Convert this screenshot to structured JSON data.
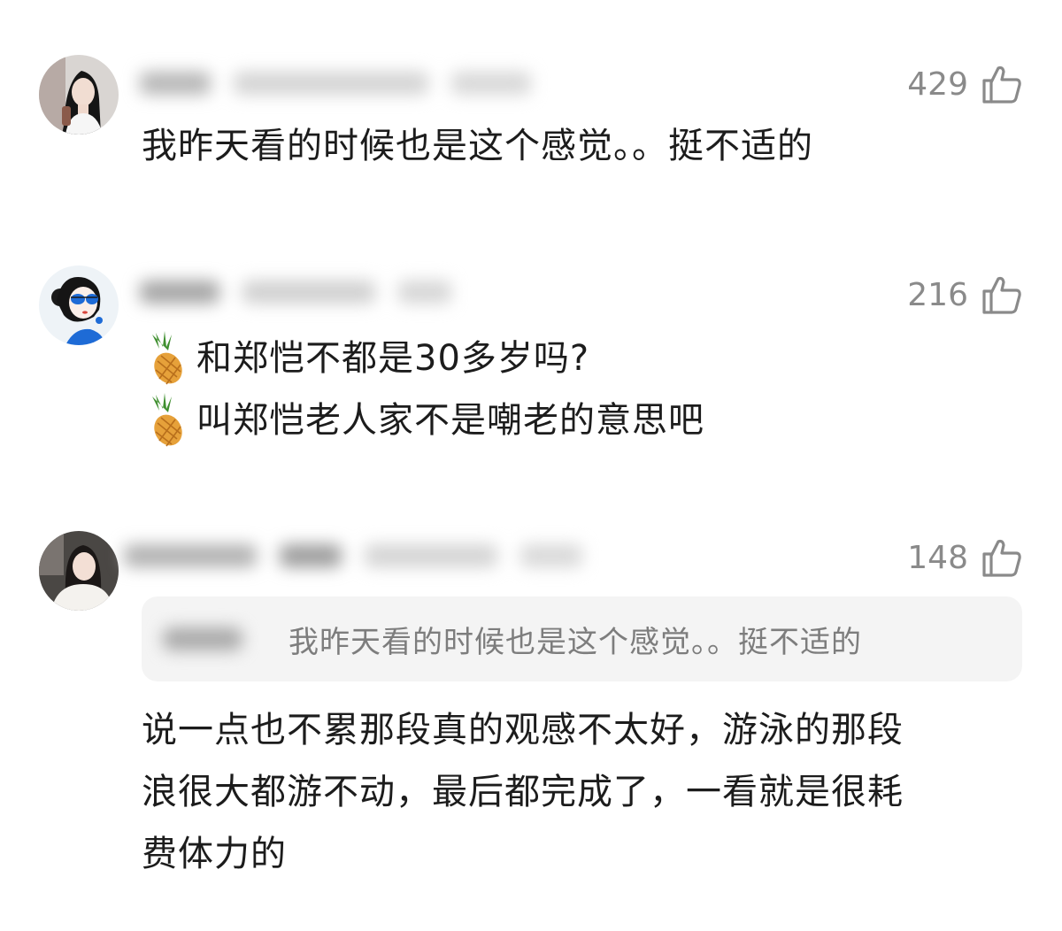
{
  "comments": [
    {
      "likes": "429",
      "lines": [
        "我昨天看的时候也是这个感觉。。挺不适的"
      ],
      "avatar_icon": "avatar-woman-dark-hair"
    },
    {
      "likes": "216",
      "lines": [
        "和郑恺不都是30多岁吗?",
        "叫郑恺老人家不是嘲老的意思吧"
      ],
      "line_emoji": "pineapple-icon",
      "avatar_icon": "avatar-illustrated-woman-blue-glasses"
    },
    {
      "likes": "148",
      "quote": "我昨天看的时候也是这个感觉。。挺不适的",
      "lines": [
        "说一点也不累那段真的观感不太好，游泳的那段",
        "浪很大都游不动，最后都完成了，一看就是很耗",
        "费体力的"
      ],
      "avatar_icon": "avatar-woman-white-coat"
    }
  ],
  "colors": {
    "text": "#1c1c1c",
    "meta": "#8a8a8a",
    "quote_bg": "#f4f4f4",
    "quote_text": "#7d7d7d"
  }
}
